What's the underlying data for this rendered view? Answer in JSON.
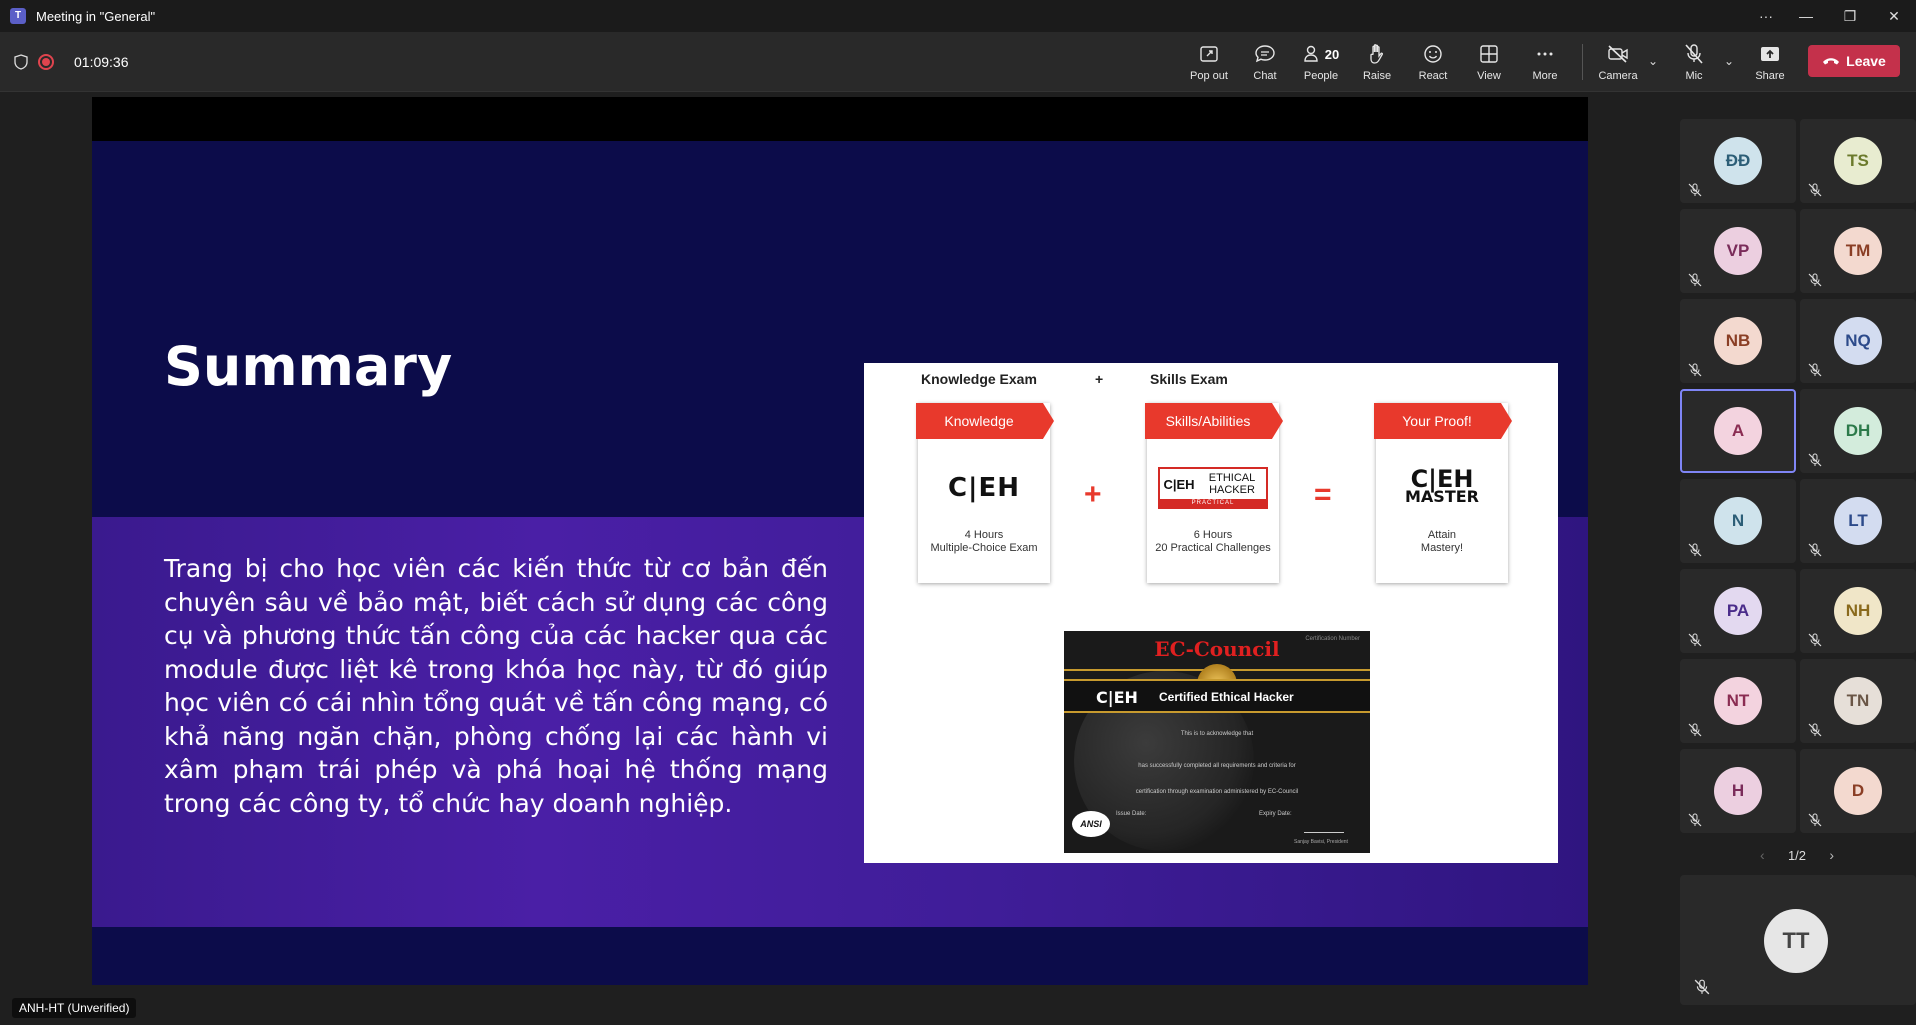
{
  "window": {
    "title": "Meeting in \"General\"",
    "app_icon": "teams-icon"
  },
  "toolbar": {
    "timer": "01:09:36",
    "buttons": {
      "popout": "Pop out",
      "chat": "Chat",
      "people": "People",
      "people_count": "20",
      "raise": "Raise",
      "react": "React",
      "view": "View",
      "more": "More",
      "camera": "Camera",
      "mic": "Mic",
      "share": "Share",
      "leave": "Leave"
    },
    "colors": {
      "leave": "#c4314b",
      "record": "#e0444e"
    }
  },
  "slide": {
    "title": "Summary",
    "body": "Trang bị cho học viên các kiến thức từ cơ bản đến chuyên sâu về bảo mật, biết cách sử dụng các công cụ và phương thức tấn công của các hacker qua các module được liệt kê trong khóa học này, từ đó giúp học viên có cái nhìn tổng quát về tấn công mạng, có khả năng ngăn chặn, phòng chống lại các hành vi xâm phạm trái phép và phá hoại hệ thống mạng trong các công ty, tổ chức hay doanh nghiệp.",
    "image": {
      "headers": {
        "knowledge_exam": "Knowledge Exam",
        "plus": "+",
        "skills_exam": "Skills Exam"
      },
      "cards": [
        {
          "tag": "Knowledge",
          "logo": "C|EH",
          "desc1": "4 Hours",
          "desc2": "Multiple-Choice Exam"
        },
        {
          "tag": "Skills/Abilities",
          "logo_c": "C|EH",
          "logo_eh": "ETHICAL HACKER",
          "logo_bar": "PRACTICAL",
          "desc1": "6 Hours",
          "desc2": "20 Practical Challenges"
        },
        {
          "tag": "Your Proof!",
          "logo_top": "C|EH",
          "logo_bottom": "MASTER",
          "desc1": "Attain",
          "desc2": "Mastery!"
        }
      ],
      "ops": {
        "plus": "+",
        "equals": "="
      },
      "certificate": {
        "brand": "EC-Council",
        "number": "Certification Number",
        "logo": "C|EH",
        "title": "Certified Ethical Hacker",
        "line1": "This is to acknowledge that",
        "line2": "has successfully completed all requirements and criteria for",
        "line3": "certification through examination administered by EC-Council",
        "ansi": "ANSI",
        "issue": "Issue Date:",
        "expiry": "Expiry Date:",
        "president": "Sanjay Bavisi, President"
      }
    }
  },
  "participants": [
    {
      "initials": "ĐĐ",
      "bg": "#cfe3ec",
      "fg": "#2c5e77"
    },
    {
      "initials": "TS",
      "bg": "#e8ecd0",
      "fg": "#6b7a2c"
    },
    {
      "initials": "VP",
      "bg": "#eccfe0",
      "fg": "#7a2c5a"
    },
    {
      "initials": "TM",
      "bg": "#f3d9cf",
      "fg": "#8a3e25"
    },
    {
      "initials": "NB",
      "bg": "#f3d9cf",
      "fg": "#8a3e25"
    },
    {
      "initials": "NQ",
      "bg": "#d3dcf0",
      "fg": "#2c4a8a"
    },
    {
      "initials": "A",
      "bg": "#f3d3df",
      "fg": "#8a2c52"
    },
    {
      "initials": "DH",
      "bg": "#d3ecdc",
      "fg": "#2c7a4a"
    },
    {
      "initials": "N",
      "bg": "#cfe3ec",
      "fg": "#2c5e77"
    },
    {
      "initials": "LT",
      "bg": "#d3dcf0",
      "fg": "#2c4a8a"
    },
    {
      "initials": "PA",
      "bg": "#e3d9f0",
      "fg": "#4a2c8a"
    },
    {
      "initials": "NH",
      "bg": "#f0e6c8",
      "fg": "#8a6a1c"
    },
    {
      "initials": "NT",
      "bg": "#f3d3df",
      "fg": "#8a2c52"
    },
    {
      "initials": "TN",
      "bg": "#e6dfd8",
      "fg": "#6a5646"
    },
    {
      "initials": "H",
      "bg": "#eccfe0",
      "fg": "#7a2c5a"
    },
    {
      "initials": "D",
      "bg": "#f3d9cf",
      "fg": "#8a3e25"
    }
  ],
  "pager": {
    "label": "1/2",
    "prev": "‹",
    "next": "›"
  },
  "self": {
    "initials": "TT"
  },
  "presenter_label": "ANH-HT (Unverified)"
}
